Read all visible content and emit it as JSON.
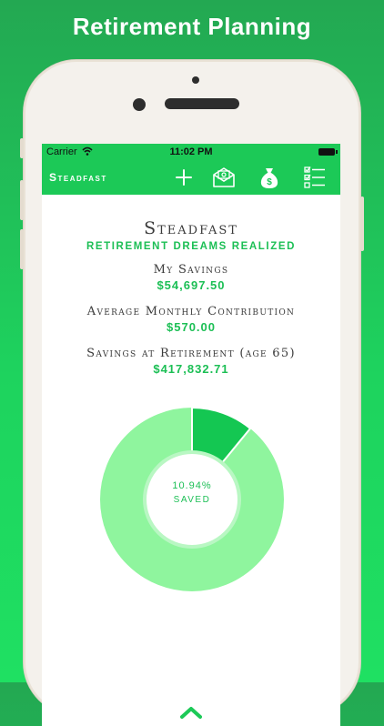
{
  "headline": "Retirement Planning",
  "status_bar": {
    "carrier": "Carrier",
    "time": "11:02 PM"
  },
  "nav": {
    "brand": "Steadfast"
  },
  "app": {
    "title": "Steadfast",
    "tagline": "Retirement Dreams Realized"
  },
  "stats": [
    {
      "label": "My Savings",
      "value": "$54,697.50"
    },
    {
      "label": "Average Monthly Contribution",
      "value": "$570.00"
    },
    {
      "label": "Savings at Retirement (age 65)",
      "value": "$417,832.71"
    }
  ],
  "donut": {
    "percent_label": "10.94%",
    "saved_label": "saved",
    "saved_fraction": 0.1094
  },
  "colors": {
    "brand_green": "#1cc957",
    "light_green": "#8ff59e",
    "dark_green": "#14c752"
  },
  "icons": [
    "plus-icon",
    "envelope-money-icon",
    "money-bag-icon",
    "checklist-icon",
    "chevron-up-icon",
    "wifi-icon",
    "battery-icon"
  ]
}
